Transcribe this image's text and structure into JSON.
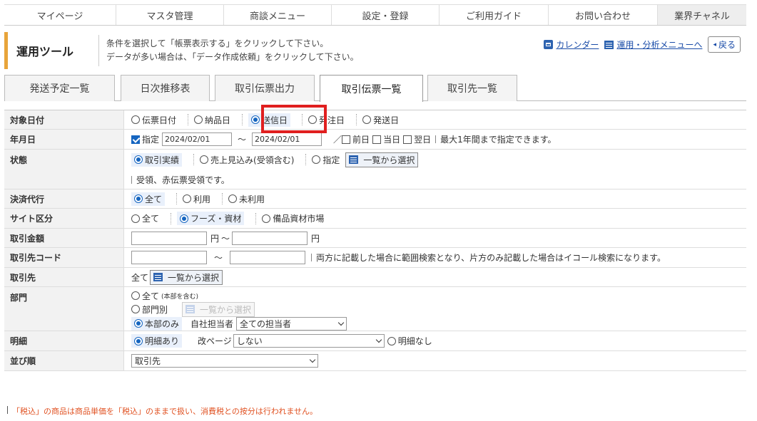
{
  "topnav": [
    "マイページ",
    "マスタ管理",
    "商談メニュー",
    "設定・登録",
    "ご利用ガイド",
    "お問い合わせ",
    "業界チャネル"
  ],
  "header": {
    "title": "運用ツール",
    "msg1": "条件を選択して「帳票表示する」をクリックして下さい。",
    "msg2": "データが多い場合は、「データ作成依頼」をクリックして下さい。",
    "calendar": "カレンダー",
    "analysis": "運用・分析メニューへ",
    "back": "戻る"
  },
  "tabs": [
    "発送予定一覧",
    "日次推移表",
    "取引伝票出力",
    "取引伝票一覧",
    "取引先一覧"
  ],
  "form": {
    "taisho": {
      "label": "対象日付",
      "opts": [
        "伝票日付",
        "納品日",
        "送信日",
        "発注日",
        "発送日"
      ]
    },
    "date": {
      "label": "年月日",
      "check": "指定",
      "from": "2024/02/01",
      "tilde": "〜",
      "to": "2024/02/01",
      "slash": "／",
      "opts": [
        "前日",
        "当日",
        "翌日"
      ],
      "note": "最大1年間まで指定できます。"
    },
    "jotai": {
      "label": "状態",
      "opts": [
        "取引実績",
        "売上見込み(受領含む)",
        "指定"
      ],
      "btn": "一覧から選択",
      "note": "受領、赤伝票受領です。"
    },
    "kessai": {
      "label": "決済代行",
      "opts": [
        "全て",
        "利用",
        "未利用"
      ]
    },
    "site": {
      "label": "サイト区分",
      "opts": [
        "全て",
        "フーズ・資材",
        "備品資材市場"
      ]
    },
    "kingaku": {
      "label": "取引金額",
      "unit1": "円",
      "tilde": "〜",
      "unit2": "円"
    },
    "code": {
      "label": "取引先コード",
      "tilde": "〜",
      "note": "両方に記載した場合に範囲検索となり、片方のみ記載した場合はイコール検索になります。"
    },
    "torihiki": {
      "label": "取引先",
      "all": "全て",
      "btn": "一覧から選択"
    },
    "bumon": {
      "label": "部門",
      "opt1": "全て",
      "opt1sub": "(本部を含む)",
      "opt2": "部門別",
      "btn": "一覧から選択",
      "opt3": "本部のみ",
      "tanto_label": "自社担当者",
      "tanto": "全ての担当者"
    },
    "meisai": {
      "label": "明細",
      "opt1": "明細あり",
      "page_label": "改ページ",
      "page": "しない",
      "opt2": "明細なし"
    },
    "narabi": {
      "label": "並び順",
      "value": "取引先"
    }
  },
  "footer_note": "「税込」の商品は商品単価を「税込」のままで扱い、消費税との按分は行われません。"
}
